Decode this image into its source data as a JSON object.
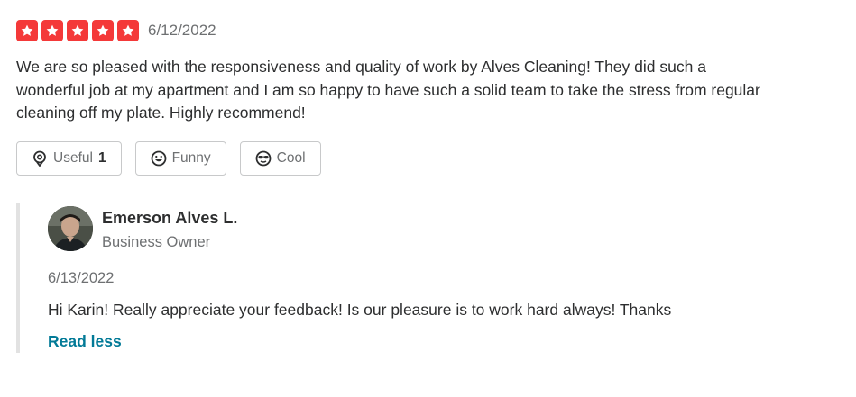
{
  "review": {
    "rating": 5,
    "rating_max": 5,
    "star_color": "#f43939",
    "date": "6/12/2022",
    "text": "We are so pleased with the responsiveness and quality of work by Alves Cleaning! They did such a wonderful job at my apartment and I am so happy to have such a solid team to take the stress from regular cleaning off my plate. Highly recommend!"
  },
  "reactions": {
    "useful": {
      "label": "Useful",
      "count": "1",
      "icon": "lightbulb-icon"
    },
    "funny": {
      "label": "Funny",
      "icon": "smile-icon"
    },
    "cool": {
      "label": "Cool",
      "icon": "sunglasses-icon"
    }
  },
  "owner_reply": {
    "name": "Emerson Alves L.",
    "role": "Business Owner",
    "date": "6/13/2022",
    "text": "Hi Karin! Really appreciate your feedback! Is our pleasure is to work hard always! Thanks",
    "read_less": "Read less",
    "link_color": "#027a97"
  }
}
